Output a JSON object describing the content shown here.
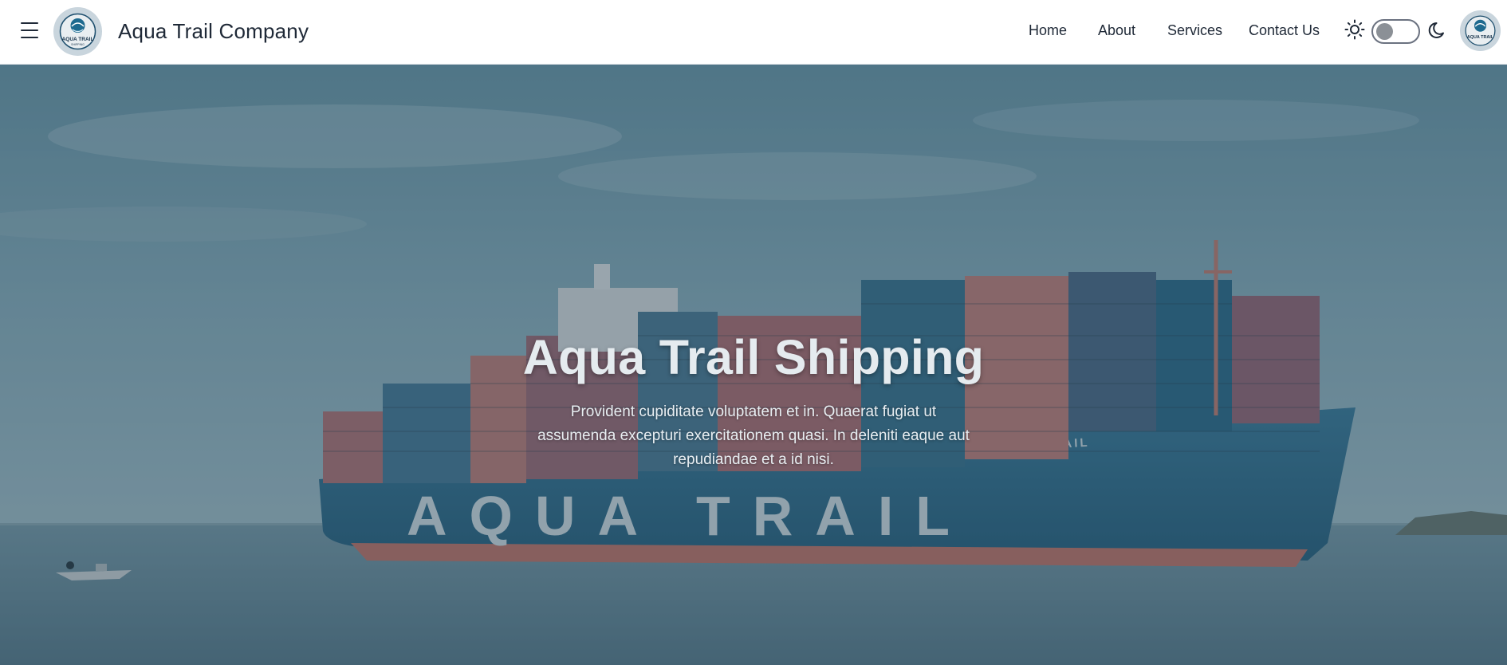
{
  "nav": {
    "brand": "Aqua Trail Company",
    "logo_text": "AQUA TRAIL",
    "links": [
      {
        "label": "Home"
      },
      {
        "label": "About"
      },
      {
        "label": "Services"
      },
      {
        "label": "Contact Us"
      }
    ],
    "theme_toggle": {
      "state": "light"
    }
  },
  "hero": {
    "title": "Aqua Trail Shipping",
    "description": "Provident cupiditate voluptatem et in. Quaerat fugiat ut assumenda excepturi exercitationem quasi. In deleniti eaque aut repudiandae et a id nisi.",
    "ship_hull_text": "AQUA TRAIL",
    "ship_bow_text": "AQUA TRAIL"
  },
  "colors": {
    "navbar_bg": "#ffffff",
    "text_dark": "#1f2937",
    "hero_overlay": "#1e3746",
    "hero_text": "#e5ebef"
  },
  "icons": [
    "hamburger-icon",
    "sun-icon",
    "moon-icon"
  ]
}
